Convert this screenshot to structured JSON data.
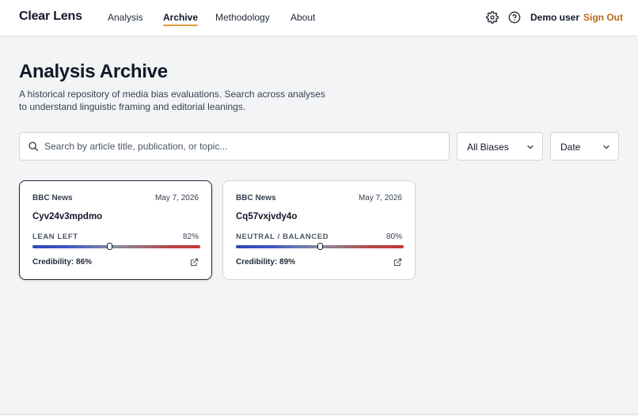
{
  "header": {
    "brand": "Clear Lens",
    "nav": [
      {
        "label": "Analysis",
        "active": false
      },
      {
        "label": "Archive",
        "active": true
      },
      {
        "label": "Methodology",
        "active": false
      },
      {
        "label": "About",
        "active": false
      }
    ],
    "settings_icon": "gear-icon",
    "help_icon": "help-circle-icon",
    "user_name": "Demo user",
    "sign_out_label": "Sign Out",
    "accent_color": "#e39a3b",
    "sign_out_color": "#b86a1c"
  },
  "page": {
    "title": "Analysis Archive",
    "description": "A historical repository of media bias evaluations. Search across analyses to understand linguistic framing and editorial leanings."
  },
  "filters": {
    "search_placeholder": "Search by article title, publication, or topic...",
    "search_value": "",
    "search_icon": "search-icon",
    "bias_select": "All Biases",
    "sort_select": "Date",
    "chevron_icon": "chevron-down-icon"
  },
  "cards": [
    {
      "source": "BBC News",
      "date": "May 7, 2026",
      "title": "Cyv24v3mpdmo",
      "bias_label": "LEAN LEFT",
      "confidence": "82%",
      "bias_position": 0.46,
      "credibility": "Credibility: 86%",
      "selected": true,
      "external_icon": "external-link-icon"
    },
    {
      "source": "BBC News",
      "date": "May 7, 2026",
      "title": "Cq57vxjvdy4o",
      "bias_label": "NEUTRAL / BALANCED",
      "confidence": "80%",
      "bias_position": 0.5,
      "credibility": "Credibility: 89%",
      "selected": false,
      "external_icon": "external-link-icon"
    }
  ],
  "bias_gradient": {
    "left": "#2f46b8",
    "center": "#8a8ea0",
    "right": "#c73532"
  }
}
